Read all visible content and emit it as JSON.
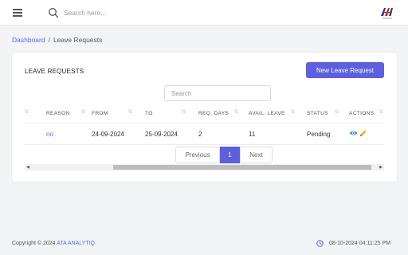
{
  "topbar": {
    "search_placeholder": "Search here...",
    "icons": {
      "menu": "hamburger-icon",
      "search": "search-icon",
      "logo": "company-logo"
    }
  },
  "breadcrumb": {
    "parent": "Dashboard",
    "separator": "/",
    "current": "Leave Requests"
  },
  "card": {
    "title": "LEAVE REQUESTS",
    "new_button": "New Leave Request",
    "search_placeholder": "Search"
  },
  "table": {
    "headers": [
      "REASON",
      "FROM",
      "TO",
      "REQ. DAYS",
      "AVAIL. LEAVE",
      "STATUS",
      "ACTIONS"
    ],
    "rows": [
      {
        "reason": "no",
        "from": "24-09-2024",
        "to": "25-09-2024",
        "req_days": "2",
        "avail_leave": "11",
        "status": "Pending"
      }
    ]
  },
  "pagination": {
    "prev": "Previous",
    "current": "1",
    "next": "Next"
  },
  "footer": {
    "copyright_prefix": "Copyright © 2024",
    "brand": "ATA ANALYTIQ.",
    "datetime": "08-10-2024 04:11:25 PM"
  },
  "colors": {
    "accent": "#5b5fe0",
    "link": "#4f6df5",
    "edit_icon": "#f2b01e",
    "view_icon": "#2d8fe0"
  }
}
